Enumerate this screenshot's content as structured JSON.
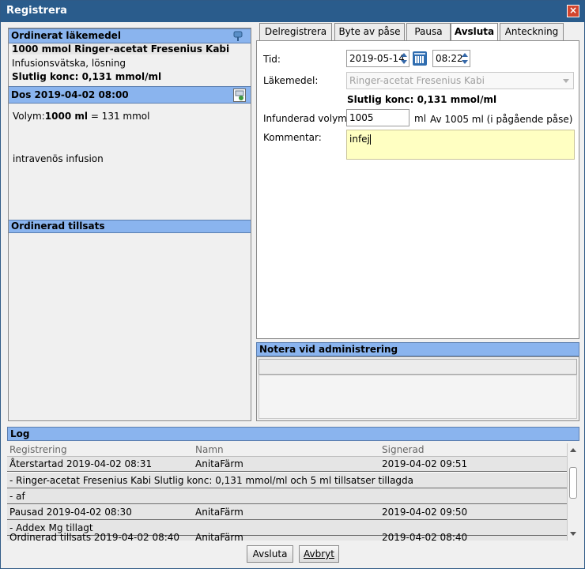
{
  "window": {
    "title": "Registrera",
    "close_label": "×"
  },
  "left": {
    "ordinerat_header": "Ordinerat läkemedel",
    "drug_name": "1000 mmol Ringer-acetat Fresenius Kabi",
    "drug_form": "Infusionsvätska, lösning",
    "drug_conc": "Slutlig konc: 0,131 mmol/ml",
    "dos_header": "Dos 2019-04-02 08:00",
    "volym_label": "Volym:",
    "volym_value": "1000 ml",
    "volym_rest": " = 131 mmol",
    "route": "intravenös infusion",
    "tillsats_header": "Ordinerad tillsats"
  },
  "tabs": [
    "Delregistrera",
    "Byte av påse",
    "Pausa",
    "Avsluta",
    "Anteckning"
  ],
  "active_tab": "Avsluta",
  "form": {
    "tid_label": "Tid:",
    "date_value": "2019-05-14",
    "time_value": "08:22",
    "lakemedel_label": "Läkemedel:",
    "lakemedel_value": "Ringer-acetat Fresenius Kabi",
    "slutlig_konc": "Slutlig konc: 0,131 mmol/ml",
    "volym_label": "Infunderad volym :",
    "volym_value": "1005",
    "volym_unit": "ml",
    "volym_hint": "Av 1005 ml (i pågående påse)",
    "kommentar_label": "Kommentar:",
    "kommentar_value": "infej"
  },
  "notera_header": "Notera vid administrering",
  "log": {
    "header": "Log",
    "columns": [
      "Registrering",
      "Namn",
      "Signerad"
    ],
    "rows": [
      {
        "registrering": "Återstartad 2019-04-02 08:31",
        "namn": "AnitaFärm",
        "signerad": "2019-04-02 09:51"
      },
      {
        "registrering": "- Ringer-acetat Fresenius Kabi   Slutlig konc: 0,131 mmol/ml och 5 ml tillsatser tillagda",
        "namn": "",
        "signerad": ""
      },
      {
        "registrering": "- af",
        "namn": "",
        "signerad": ""
      },
      {
        "registrering": "Pausad 2019-04-02 08:30",
        "namn": "AnitaFärm",
        "signerad": "2019-04-02 09:50"
      },
      {
        "registrering": "- Addex Mg tillagt",
        "namn": "",
        "signerad": ""
      },
      {
        "registrering": "Ordinerad tillsats 2019-04-02 08:40",
        "namn": "AnitaFärm",
        "signerad": "2019-04-02 08:40"
      }
    ]
  },
  "buttons": {
    "avsluta": "Avsluta",
    "avbryt": "Avbryt"
  },
  "icons": [
    "pin-icon",
    "calendar-icon",
    "save-dose-icon"
  ]
}
